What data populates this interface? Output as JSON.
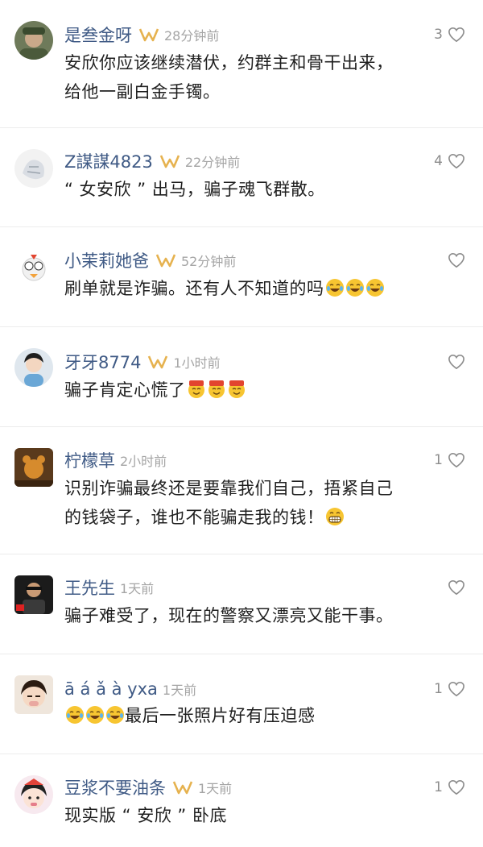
{
  "colors": {
    "username": "#3f5a85",
    "badge": "#e6b24f",
    "time": "#a5a5a5",
    "text": "#1f1f1f",
    "like": "#8c8c8c"
  },
  "comments": [
    {
      "username": "是叁金呀",
      "time": "28分钟前",
      "likes": "3",
      "text_lines": [
        "安欣你应该继续潜伏，约群主和骨干出来，",
        "给他一副白金手镯。"
      ],
      "emoji": ""
    },
    {
      "username": "Z謀謀4823",
      "time": "22分钟前",
      "likes": "4",
      "text_lines": [
        "“ 女安欣 ” 出马，骗子魂飞群散。"
      ],
      "emoji": ""
    },
    {
      "username": "小茉莉她爸",
      "time": "52分钟前",
      "likes": "",
      "text_lines": [
        "刷单就是诈骗。还有人不知道的吗"
      ],
      "emoji": "laugh-cry-emoji"
    },
    {
      "username": "牙牙8774",
      "time": "1小时前",
      "likes": "",
      "text_lines": [
        "骗子肯定心慌了"
      ],
      "emoji": "666-emoji"
    },
    {
      "username": "柠檬草",
      "time": "2小时前",
      "likes": "1",
      "text_lines": [
        "识别诈骗最终还是要靠我们自己，捂紧自己",
        "的钱袋子，谁也不能骗走我的钱！"
      ],
      "emoji": "grin-emoji"
    },
    {
      "username": "王先生",
      "time": "1天前",
      "likes": "",
      "text_lines": [
        "骗子难受了，现在的警察又漂亮又能干事。"
      ],
      "emoji": ""
    },
    {
      "username": "ā á ǎ à yxa",
      "time": "1天前",
      "likes": "1",
      "text_lines": [
        "最后一张照片好有压迫感"
      ],
      "emoji": "laugh-cry-emoji"
    },
    {
      "username": "豆浆不要油条",
      "time": "1天前",
      "likes": "1",
      "text_lines": [
        "现实版 “ 安欣 ” 卧底"
      ],
      "emoji": ""
    }
  ]
}
